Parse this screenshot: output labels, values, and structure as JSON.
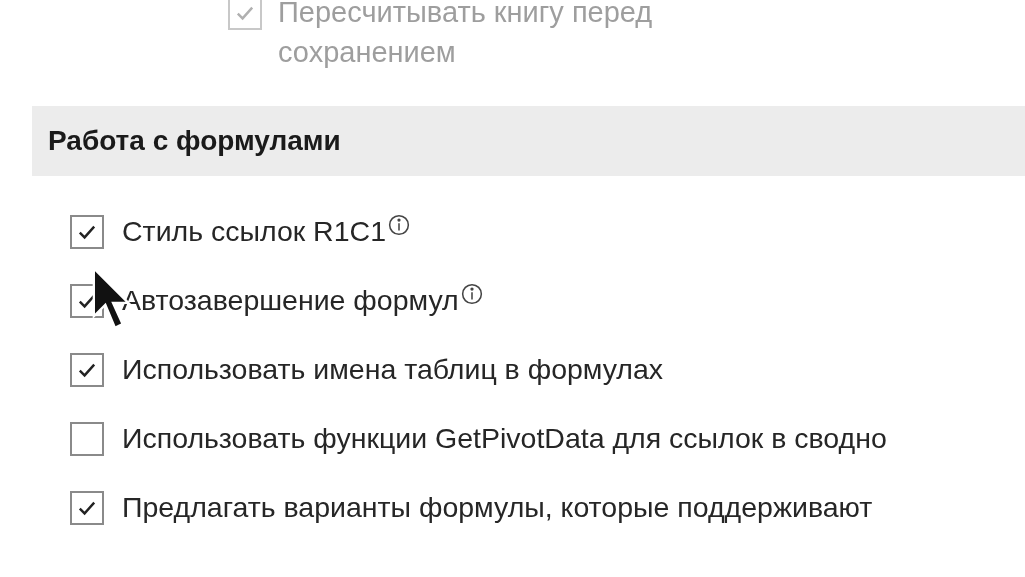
{
  "top_option": {
    "label": "Пересчитывать книгу перед сохранением",
    "checked": true,
    "disabled": true
  },
  "section": {
    "title": "Работа с формулами"
  },
  "options": [
    {
      "label": "Стиль ссылок R1C1",
      "checked": true,
      "info": true
    },
    {
      "label": "Автозавершение формул",
      "checked": true,
      "info": true
    },
    {
      "label": "Использовать имена таблиц в формулах",
      "checked": true,
      "info": false
    },
    {
      "label": "Использовать функции GetPivotData для ссылок в сводно",
      "checked": false,
      "info": false
    },
    {
      "label": "Предлагать варианты формулы, которые поддерживают",
      "checked": true,
      "info": false
    }
  ]
}
